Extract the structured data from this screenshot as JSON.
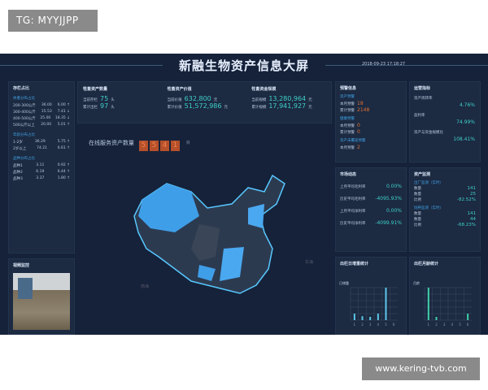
{
  "watermark_top": "TG: MYYJJPP",
  "watermark_bottom": "www.kering-tvb.com",
  "header": {
    "title": "新融生物资产信息大屏",
    "datetime": "2018-09-23 17:18:27"
  },
  "left": {
    "title": "存栏占比",
    "sections": [
      {
        "sub": "体重分布占比",
        "rows": [
          [
            "200-300公斤",
            "36.00",
            "6.00 ↑"
          ],
          [
            "300-400公斤",
            "15.53",
            "7.41 ↓"
          ],
          [
            "400-500公斤",
            "25.00",
            "18.35 ↓"
          ],
          [
            "500公斤以上",
            "20.00",
            "5.01 ↑"
          ]
        ]
      },
      {
        "sub": "年龄分布占比",
        "rows": [
          [
            "1-2岁",
            "36.29",
            "5.75 ↑"
          ],
          [
            "2岁以上",
            "74.21",
            "6.61 ↑"
          ]
        ]
      },
      {
        "sub": "品种分布占比",
        "rows": [
          [
            "品种1",
            "3.11",
            "0.92 ↑"
          ],
          [
            "品种2",
            "6.19",
            "6.44 ↑"
          ],
          [
            "品种3",
            "3.37",
            "1.80 ↑"
          ]
        ]
      }
    ]
  },
  "video": {
    "title": "视频监控"
  },
  "stats": [
    {
      "title": "牲畜资产数量",
      "rows": [
        {
          "label": "当前存栏",
          "value": "75",
          "unit": "头"
        },
        {
          "label": "累计出栏",
          "value": "97",
          "unit": "头"
        }
      ]
    },
    {
      "title": "牲畜资产价值",
      "rows": [
        {
          "label": "当前价值",
          "value": "632,800",
          "unit": "元"
        },
        {
          "label": "累计价值",
          "value": "51,572,986",
          "unit": "元"
        }
      ]
    },
    {
      "title": "牲畜资金规模",
      "rows": [
        {
          "label": "当前规模",
          "value": "13,280,964",
          "unit": "元"
        },
        {
          "label": "累计规模",
          "value": "17,941,927",
          "unit": "元"
        }
      ]
    }
  ],
  "map": {
    "label": "在线服务资产数量",
    "digits": [
      "5",
      "5",
      "4",
      "1"
    ],
    "unit": "只",
    "sea1": "东海",
    "sea2": "南海"
  },
  "warning": {
    "title": "预警信息",
    "groups": [
      {
        "sub": "资产预警",
        "rows": [
          [
            "本月预警",
            "18"
          ],
          [
            "累计预警",
            "2148"
          ]
        ]
      },
      {
        "sub": "健康预警",
        "rows": [
          [
            "本月预警",
            "0"
          ],
          [
            "累计预警",
            "0"
          ]
        ]
      },
      {
        "sub": "资产未覆盖预警",
        "rows": [
          [
            "本月预警",
            "2"
          ]
        ]
      }
    ]
  },
  "ops": {
    "title": "运营指标",
    "items": [
      {
        "label": "资产周转率",
        "value": "4.76%"
      },
      {
        "label": "盈利率",
        "value": "74.99%"
      },
      {
        "label": "资产与资金规模比",
        "value": "108.41%"
      }
    ]
  },
  "market": {
    "title": "市场动态",
    "items": [
      {
        "label": "上月平均毛利率",
        "value": "0.00%"
      },
      {
        "label": "历史平均毛利率",
        "value": "-4095.93%"
      },
      {
        "label": "上月平均净利率",
        "value": "0.00%"
      },
      {
        "label": "历史平均净利率",
        "value": "-4099.91%"
      }
    ]
  },
  "monitor": {
    "title": "资产监测",
    "groups": [
      {
        "sub": "出厂监测（实时）",
        "rows": [
          [
            "数量",
            "141"
          ],
          [
            "数量",
            "25"
          ],
          [
            "比例",
            "-82.52%"
          ]
        ]
      },
      {
        "sub": "饲养监测（实时）",
        "rows": [
          [
            "数量",
            "141"
          ],
          [
            "数量",
            "44"
          ],
          [
            "比例",
            "-68.23%"
          ]
        ]
      }
    ]
  },
  "chart_data": [
    {
      "type": "bar",
      "title": "出栏日增重统计",
      "ylabel": "日增重",
      "categories": [
        "1",
        "2",
        "3",
        "4",
        "5",
        "6"
      ],
      "values": [
        2,
        1.2,
        1,
        2,
        10,
        0
      ],
      "ylim": [
        0,
        10
      ]
    },
    {
      "type": "bar",
      "title": "出栏月龄统计",
      "ylabel": "月龄",
      "categories": [
        "1",
        "2",
        "3",
        "4",
        "5",
        "6"
      ],
      "values": [
        10,
        1,
        0,
        0,
        0,
        2
      ],
      "ylim": [
        0,
        10
      ]
    }
  ],
  "colors": {
    "bg": "#15223a",
    "panel": "#1c2a42",
    "accent": "#3fd0c8",
    "warn": "#e07030",
    "map": "#3f9ee8"
  }
}
